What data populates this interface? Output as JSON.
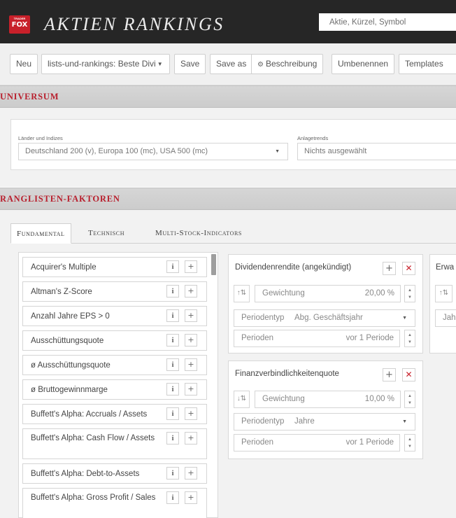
{
  "header": {
    "logo_small": "TRADER",
    "logo_main": "FOX",
    "title": "AKTIEN RANKINGS",
    "search_placeholder": "Aktie, Kürzel, Symbol"
  },
  "toolbar": {
    "new_label": "Neu",
    "list_select_label": "lists-und-rankings: Beste Divi",
    "save_label": "Save",
    "save_as_label": "Save as",
    "description_label": "Beschreibung",
    "rename_label": "Umbenennen",
    "templates_label": "Templates"
  },
  "universe": {
    "section_title": "UNIVERSUM",
    "countries_label": "Länder und Indizes",
    "countries_value": "Deutschland 200 (v), Europa 100 (mc), USA 500 (mc)",
    "trends_label": "Anlagetrends",
    "trends_placeholder": "Nichts ausgewählt"
  },
  "ranking": {
    "section_title": "RANGLISTEN-FAKTOREN",
    "tabs": [
      {
        "label": "Fundamental"
      },
      {
        "label": "Technisch"
      },
      {
        "label": "Multi-Stock-Indicators"
      }
    ],
    "factor_list": [
      {
        "label": "Acquirer's Multiple"
      },
      {
        "label": "Altman's Z-Score"
      },
      {
        "label": "Anzahl Jahre EPS > 0"
      },
      {
        "label": "Ausschüttungsquote"
      },
      {
        "label": "ø Ausschüttungsquote"
      },
      {
        "label": "ø Bruttogewinnmarge"
      },
      {
        "label": "Buffett's Alpha: Accruals / Assets"
      },
      {
        "label": "Buffett's Alpha: Cash Flow / Assets"
      },
      {
        "label": "Buffett's Alpha: Debt-to-Assets"
      },
      {
        "label": "Buffett's Alpha: Gross Profit / Sales"
      }
    ],
    "info_glyph": "i",
    "add_glyph": "+",
    "selected": [
      {
        "title": "Dividendenrendite (angekündigt)",
        "weight_label": "Gewichtung",
        "weight_value": "20,00 %",
        "period_type_label": "Periodentyp",
        "period_type_value": "Abg. Geschäftsjahr",
        "periods_label": "Perioden",
        "periods_value": "vor 1 Periode"
      },
      {
        "title": "Finanzverbindlichkeitenquote",
        "weight_label": "Gewichtung",
        "weight_value": "10,00 %",
        "period_type_label": "Periodentyp",
        "period_type_value": "Jahre",
        "periods_label": "Perioden",
        "periods_value": "vor 1 Periode"
      },
      {
        "title": "Erwa",
        "period_type_value": "Jah"
      }
    ]
  }
}
